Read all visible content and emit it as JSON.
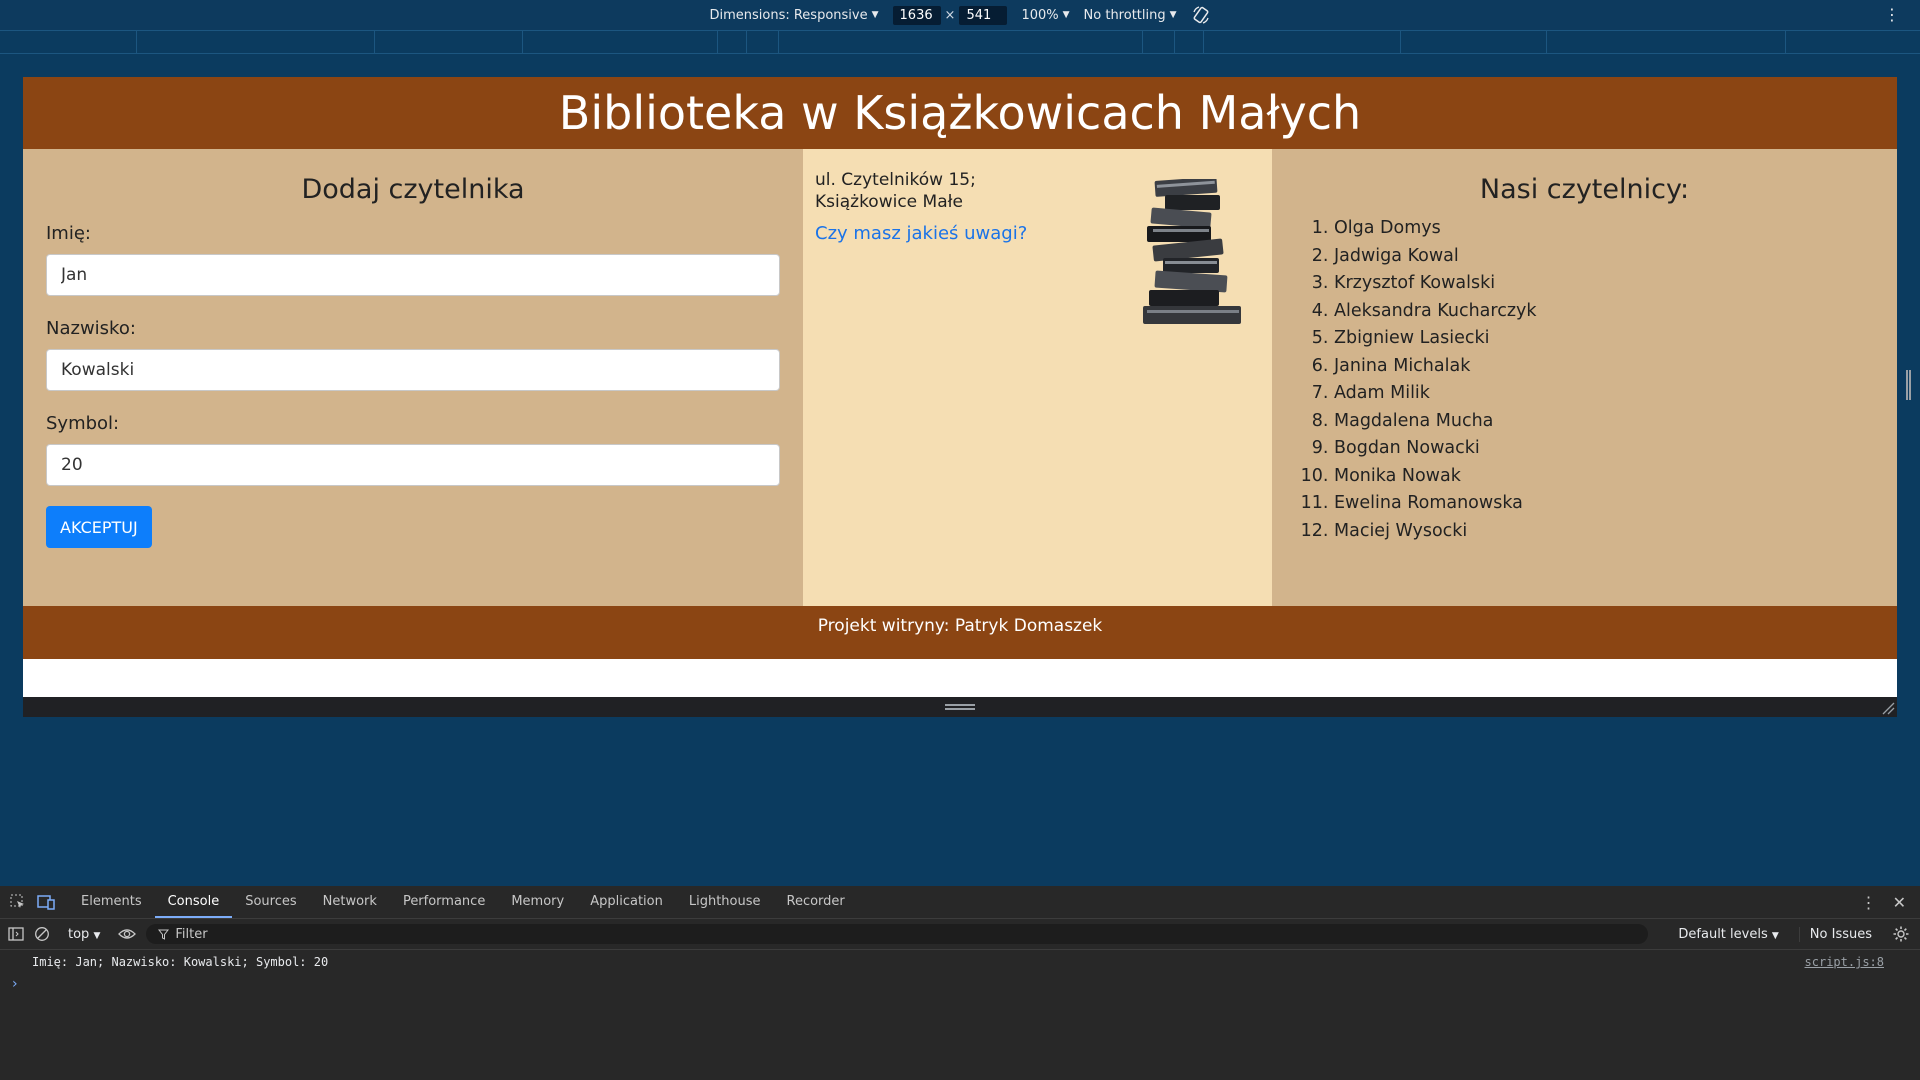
{
  "device_toolbar": {
    "dimensions_label": "Dimensions: Responsive",
    "width": "1636",
    "times": "×",
    "height": "541",
    "zoom": "100%",
    "throttling": "No throttling"
  },
  "site": {
    "title": "Biblioteka w Książkowicach Małych",
    "form": {
      "heading": "Dodaj czytelnika",
      "first_name_label": "Imię:",
      "first_name_value": "Jan",
      "last_name_label": "Nazwisko:",
      "last_name_value": "Kowalski",
      "symbol_label": "Symbol:",
      "symbol_value": "20",
      "submit_label": "AKCEPTUJ"
    },
    "address": {
      "line1": "ul. Czytelników 15;",
      "line2": "Książkowice Małe",
      "feedback_link": "Czy masz jakieś uwagi?"
    },
    "readers": {
      "heading": "Nasi czytelnicy:",
      "items": [
        "Olga Domys",
        "Jadwiga Kowal",
        "Krzysztof Kowalski",
        "Aleksandra Kucharczyk",
        "Zbigniew Lasiecki",
        "Janina Michalak",
        "Adam Milik",
        "Magdalena Mucha",
        "Bogdan Nowacki",
        "Monika Nowak",
        "Ewelina Romanowska",
        "Maciej Wysocki"
      ]
    },
    "footer": "Projekt witryny: Patryk Domaszek",
    "colors": {
      "header": "#8b4513",
      "panel": "#d2b48c",
      "center": "#f5deb3",
      "button": "#0d7efb"
    }
  },
  "devtools": {
    "tabs": [
      "Elements",
      "Console",
      "Sources",
      "Network",
      "Performance",
      "Memory",
      "Application",
      "Lighthouse",
      "Recorder"
    ],
    "active_tab": "Console",
    "context": "top",
    "filter_placeholder": "Filter",
    "levels": "Default levels",
    "issues": "No Issues",
    "log_message": "Imię: Jan; Nazwisko: Kowalski; Symbol: 20",
    "log_source": "script.js:8",
    "prompt": "›"
  }
}
